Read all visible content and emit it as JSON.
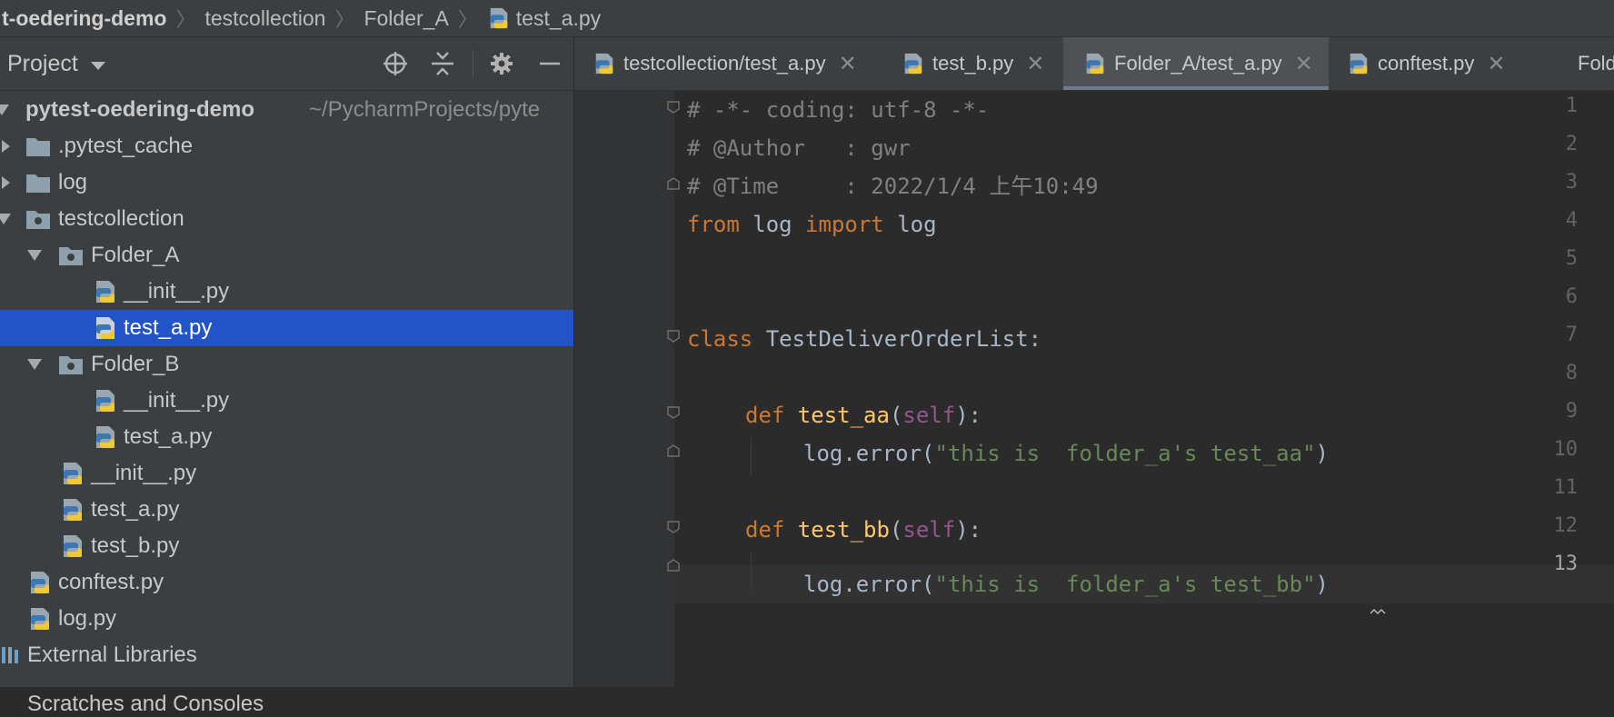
{
  "breadcrumb": {
    "items": [
      "t-oedering-demo",
      "testcollection",
      "Folder_A",
      "test_a.py"
    ]
  },
  "project_panel": {
    "title": "Project",
    "icons": [
      "locate-icon",
      "collapse-all-icon",
      "gear-icon",
      "minimize-icon"
    ]
  },
  "tree": {
    "root": {
      "name": "pytest-oedering-demo",
      "path": "~/PycharmProjects/pyte"
    },
    "items": [
      {
        "label": ".pytest_cache",
        "type": "folder"
      },
      {
        "label": "log",
        "type": "folder"
      },
      {
        "label": "testcollection",
        "type": "package"
      },
      {
        "label": "Folder_A",
        "type": "package"
      },
      {
        "label": "__init__.py",
        "type": "python-file"
      },
      {
        "label": "test_a.py",
        "type": "python-file",
        "selected": true
      },
      {
        "label": "Folder_B",
        "type": "package"
      },
      {
        "label": "__init__.py",
        "type": "python-file"
      },
      {
        "label": "test_a.py",
        "type": "python-file"
      },
      {
        "label": "__init__.py",
        "type": "python-file"
      },
      {
        "label": "test_a.py",
        "type": "python-file"
      },
      {
        "label": "test_b.py",
        "type": "python-file"
      },
      {
        "label": "conftest.py",
        "type": "python-file"
      },
      {
        "label": "log.py",
        "type": "python-file"
      },
      {
        "label": "External Libraries",
        "type": "library"
      },
      {
        "label": "Scratches and Consoles",
        "type": "scratches"
      }
    ]
  },
  "tabs": [
    {
      "label": "testcollection/test_a.py",
      "active": false
    },
    {
      "label": "test_b.py",
      "active": false
    },
    {
      "label": "Folder_A/test_a.py",
      "active": true
    },
    {
      "label": "conftest.py",
      "active": false
    },
    {
      "label": "Folde",
      "active": false
    }
  ],
  "editor": {
    "line_numbers": [
      "1",
      "2",
      "3",
      "4",
      "5",
      "6",
      "7",
      "8",
      "9",
      "10",
      "11",
      "12",
      "13"
    ],
    "current_line": "13",
    "lines": {
      "l1": "# -*- coding: utf-8 -*-",
      "l2": "# @Author   : gwr",
      "l3": "# @Time     : 2022/1/4 上午10:49",
      "l4_kw1": "from",
      "l4_mod": " log ",
      "l4_kw2": "import",
      "l4_name": " log",
      "l7_kw": "class",
      "l7_name": " TestDeliverOrderList:",
      "l9_kw": "def",
      "l9_fn": " test_aa",
      "l9_open": "(",
      "l9_self": "self",
      "l9_close": "):",
      "l10_call": "log.error(",
      "l10_str": "\"this is  folder_a's test_aa\"",
      "l10_close": ")",
      "l12_kw": "def",
      "l12_fn": " test_bb",
      "l12_open": "(",
      "l12_self": "self",
      "l12_close": "):",
      "l13_call": "log.error(",
      "l13_str": "\"this is  folder_a's test_bb\"",
      "l13_close": ")"
    }
  },
  "colors": {
    "selection": "#2354c7",
    "keyword": "#cc7832",
    "function": "#ffc66d",
    "string": "#6a8759",
    "comment": "#808080",
    "self": "#94558d"
  }
}
